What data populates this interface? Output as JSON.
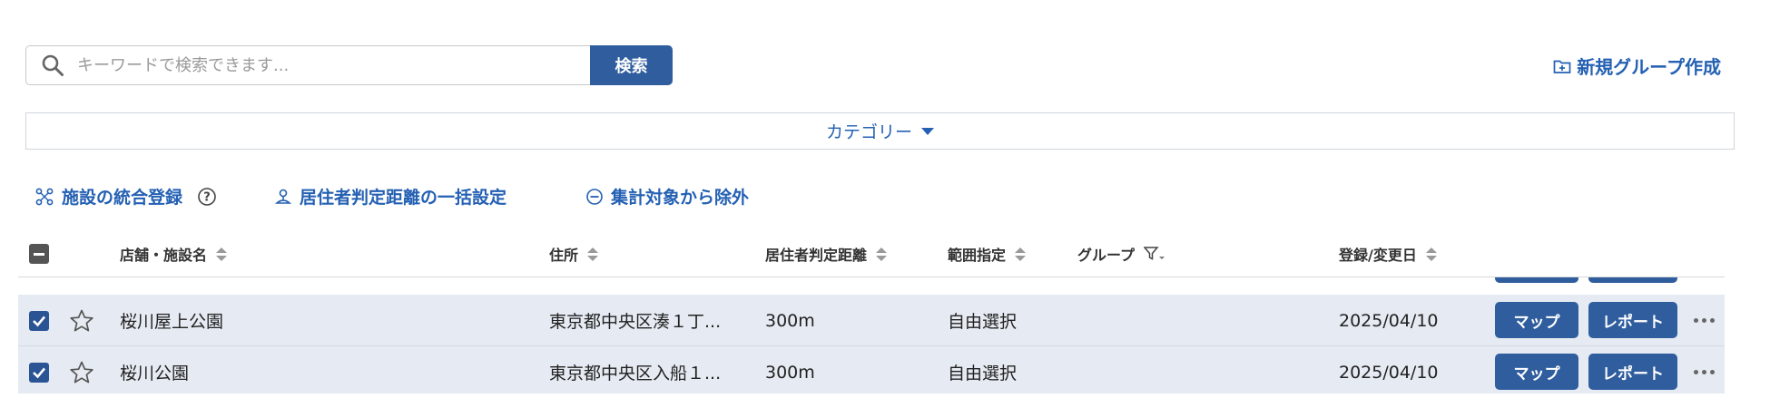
{
  "search": {
    "placeholder": "キーワードで検索できます...",
    "value": "",
    "button_label": "検索"
  },
  "header_actions": {
    "new_group_label": "新規グループ作成"
  },
  "category": {
    "label": "カテゴリー"
  },
  "actions": [
    {
      "label": "施設の統合登録",
      "icon": "merge-icon"
    },
    {
      "label": "居住者判定距離の一括設定",
      "icon": "person-pin-icon"
    },
    {
      "label": "集計対象から除外",
      "icon": "minus-circle-icon"
    }
  ],
  "table": {
    "columns": {
      "name": "店舗・施設名",
      "address": "住所",
      "distance": "居住者判定距離",
      "range": "範囲指定",
      "group": "グループ",
      "date": "登録/変更日"
    },
    "rows": [
      {
        "checked": true,
        "starred": false,
        "name": "桜川屋上公園",
        "address": "東京都中央区湊１丁...",
        "distance": "300m",
        "range": "自由選択",
        "group": "",
        "date": "2025/04/10",
        "map_label": "マップ",
        "report_label": "レポート"
      },
      {
        "checked": true,
        "starred": false,
        "name": "桜川公園",
        "address": "東京都中央区入船１...",
        "distance": "300m",
        "range": "自由選択",
        "group": "",
        "date": "2025/04/10",
        "map_label": "マップ",
        "report_label": "レポート"
      }
    ]
  },
  "colors": {
    "primary": "#2f5d9e",
    "link": "#2460b3",
    "row_selected": "#e6ebf3"
  }
}
